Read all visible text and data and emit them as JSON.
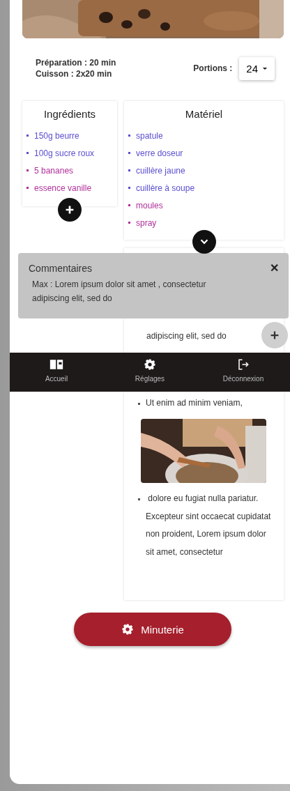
{
  "recipe": {
    "preparation": "Préparation : 20 min",
    "cooking": "Cuisson : 2x20 min",
    "portions_label": "Portions :",
    "portions_value": "24"
  },
  "ingredients": {
    "title": "Ingrédients",
    "items": [
      {
        "text": "150g beurre",
        "color": "#5a4fcf"
      },
      {
        "text": "100g sucre roux",
        "color": "#5a4fcf"
      },
      {
        "text": "5 bananes",
        "color": "#b0309a"
      },
      {
        "text": "essence vanille",
        "color": "#b0309a"
      }
    ]
  },
  "equipment": {
    "title": "Matériel",
    "items": [
      {
        "text": "spatule",
        "color": "#5a4fcf"
      },
      {
        "text": "verre doseur",
        "color": "#5a4fcf"
      },
      {
        "text": "cuillère jaune",
        "color": "#5a4fcf"
      },
      {
        "text": "cuillère à soupe",
        "color": "#5a4fcf"
      },
      {
        "text": "moules",
        "color": "#b0309a"
      },
      {
        "text": "spray",
        "color": "#b0309a"
      }
    ]
  },
  "steps": [
    {
      "kind": "text",
      "bullet": false,
      "text": "adipiscing elit, sed do"
    },
    {
      "kind": "text",
      "bullet": true,
      "text": "Ut enim ad minim veniam,"
    },
    {
      "kind": "picture"
    },
    {
      "kind": "text",
      "bullet": true,
      "text": " dolore eu fugiat nulla pariatur.\nExcepteur sint occaecat cupidatat non proident, Lorem ipsum dolor sit amet, consectetur"
    }
  ],
  "comments": {
    "title": "Commentaires",
    "close": "✕",
    "text": "Max : Lorem ipsum dolor sit amet , consectetur adipiscing elit, sed do"
  },
  "nav": [
    {
      "label": "Accueil",
      "kind": "book"
    },
    {
      "label": "Réglages",
      "kind": "gear"
    },
    {
      "label": "Déconnexion",
      "kind": "logout"
    }
  ],
  "timer_button": "Minuterie"
}
